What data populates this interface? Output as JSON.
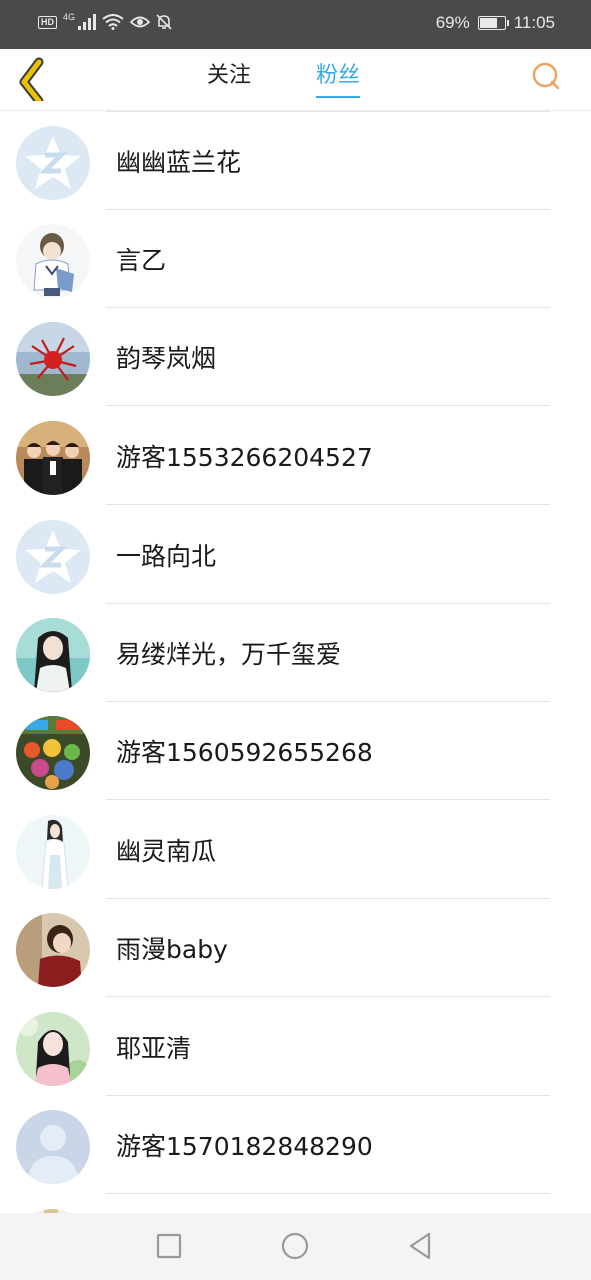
{
  "status_bar": {
    "hd_label": "HD",
    "signal_label": "4G",
    "battery_percent": "69%",
    "battery_level": 0.69,
    "time": "11:05"
  },
  "header": {
    "tabs": [
      {
        "label": "关注",
        "active": false
      },
      {
        "label": "粉丝",
        "active": true
      }
    ],
    "accent_color": "#3aa8e4",
    "back_icon_color": "#e8c400",
    "search_icon_color": "#f0a060"
  },
  "fans": [
    {
      "name": "幽幽蓝兰花",
      "avatar": "default-qq-avatar"
    },
    {
      "name": "言乙",
      "avatar": "anime-boy-avatar"
    },
    {
      "name": "韵琴岚烟",
      "avatar": "red-flower-avatar"
    },
    {
      "name": "游客1553266204527",
      "avatar": "group-photo-avatar"
    },
    {
      "name": "一路向北",
      "avatar": "default-qq-avatar"
    },
    {
      "name": "易缕烊光，万千玺爱",
      "avatar": "costume-portrait-avatar"
    },
    {
      "name": "游客1560592655268",
      "avatar": "game-poster-avatar"
    },
    {
      "name": "幽灵南瓜",
      "avatar": "girl-in-white-avatar"
    },
    {
      "name": "雨漫baby",
      "avatar": "girl-profile-avatar"
    },
    {
      "name": "耶亚清",
      "avatar": "girl-portrait-avatar"
    },
    {
      "name": "游客1570182848290",
      "avatar": "default-user-avatar"
    }
  ],
  "nav_bar": {
    "buttons": [
      "recent-apps",
      "home",
      "back"
    ]
  }
}
